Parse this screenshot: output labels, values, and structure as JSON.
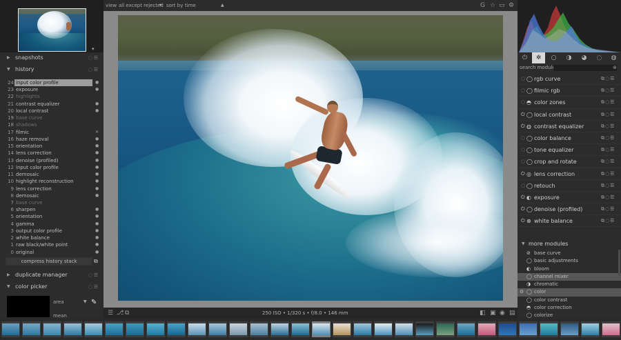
{
  "navigation": {
    "zoom_label": "▾"
  },
  "left_sections": {
    "snapshots": "snapshots",
    "history": "history",
    "duplicate_manager": "duplicate manager",
    "color_picker": "color picker"
  },
  "history": [
    {
      "num": "24",
      "name": "input color profile",
      "state": "●",
      "selected": true,
      "disabled": false
    },
    {
      "num": "23",
      "name": "exposure",
      "state": "●",
      "disabled": false
    },
    {
      "num": "22",
      "name": "highlights",
      "state": "",
      "disabled": true
    },
    {
      "num": "21",
      "name": "contrast equalizer",
      "state": "●",
      "disabled": false
    },
    {
      "num": "20",
      "name": "local contrast",
      "state": "●",
      "disabled": false
    },
    {
      "num": "19",
      "name": "base curve",
      "state": "",
      "disabled": true
    },
    {
      "num": "18",
      "name": "shadows",
      "state": "",
      "disabled": true
    },
    {
      "num": "17",
      "name": "filmic",
      "state": "✕",
      "disabled": false
    },
    {
      "num": "16",
      "name": "haze removal",
      "state": "●",
      "disabled": false
    },
    {
      "num": "15",
      "name": "orientation",
      "state": "●",
      "disabled": false
    },
    {
      "num": "14",
      "name": "lens correction",
      "state": "●",
      "disabled": false
    },
    {
      "num": "13",
      "name": "denoise (profiled)",
      "state": "●",
      "disabled": false
    },
    {
      "num": "12",
      "name": "input color profile",
      "state": "●",
      "disabled": false
    },
    {
      "num": "11",
      "name": "demosaic",
      "state": "●",
      "disabled": false
    },
    {
      "num": "10",
      "name": "highlight reconstruction",
      "state": "●",
      "disabled": false
    },
    {
      "num": "9",
      "name": "lens correction",
      "state": "●",
      "disabled": false
    },
    {
      "num": "8",
      "name": "demosaic",
      "state": "●",
      "disabled": false
    },
    {
      "num": "7",
      "name": "base curve",
      "state": "",
      "disabled": true
    },
    {
      "num": "6",
      "name": "sharpen",
      "state": "●",
      "disabled": false
    },
    {
      "num": "5",
      "name": "orientation",
      "state": "●",
      "disabled": false
    },
    {
      "num": "4",
      "name": "gamma",
      "state": "●",
      "disabled": false
    },
    {
      "num": "3",
      "name": "output color profile",
      "state": "●",
      "disabled": false
    },
    {
      "num": "2",
      "name": "white balance",
      "state": "●",
      "disabled": false
    },
    {
      "num": "1",
      "name": "raw black/white point",
      "state": "●",
      "disabled": false
    },
    {
      "num": "0",
      "name": "original",
      "state": "●",
      "disabled": false
    }
  ],
  "compress_history_label": "compress history stack",
  "color_picker": {
    "area_label": "area",
    "mean_label": "mean",
    "swatch_color": "#000000"
  },
  "topbar": {
    "view_label": "view",
    "filter_value": "all except rejected",
    "sort_label": "sort by",
    "sort_value": "time"
  },
  "exif_info": "250 ISO • 1/320 s • f/8.0 • 146 mm",
  "module_search": {
    "label": "search module",
    "placeholder": ""
  },
  "modules": [
    {
      "name": "rgb curve",
      "on": false,
      "icon": "◯"
    },
    {
      "name": "filmic rgb",
      "on": false,
      "icon": "◯"
    },
    {
      "name": "color zones",
      "on": false,
      "icon": "◓"
    },
    {
      "name": "local contrast",
      "on": true,
      "icon": "◯"
    },
    {
      "name": "contrast equalizer",
      "on": true,
      "icon": "◍"
    },
    {
      "name": "color balance",
      "on": false,
      "icon": "◯"
    },
    {
      "name": "tone equalizer",
      "on": false,
      "icon": "◯"
    },
    {
      "name": "crop and rotate",
      "on": false,
      "icon": "◯"
    },
    {
      "name": "lens correction",
      "on": true,
      "icon": "◎"
    },
    {
      "name": "retouch",
      "on": false,
      "icon": "◯"
    },
    {
      "name": "exposure",
      "on": true,
      "icon": "◐"
    },
    {
      "name": "denoise (profiled)",
      "on": true,
      "icon": "◯"
    },
    {
      "name": "white balance",
      "on": true,
      "icon": "⊕"
    }
  ],
  "more_modules_label": "more modules",
  "more_modules": [
    {
      "name": "base curve",
      "icon": "⊘",
      "disabled": false,
      "hl": false
    },
    {
      "name": "basic adjustments",
      "icon": "◯",
      "disabled": false,
      "hl": false
    },
    {
      "name": "bloom",
      "icon": "◐",
      "disabled": false,
      "hl": false
    },
    {
      "name": "channel mixer",
      "icon": "◯",
      "disabled": false,
      "hl": true
    },
    {
      "name": "chromatic",
      "icon": "◑",
      "disabled": false,
      "hl": false
    },
    {
      "name": "color",
      "icon": "◯",
      "disabled": false,
      "hl": true
    },
    {
      "name": "color contrast",
      "icon": "◯",
      "disabled": false,
      "hl": false
    },
    {
      "name": "color correction",
      "icon": "◓",
      "disabled": false,
      "hl": false
    },
    {
      "name": "colorize",
      "icon": "◯",
      "disabled": false,
      "hl": false
    }
  ],
  "colors": {
    "accent": "#d8d8d8",
    "panel_bg": "#2c2c2c",
    "center_bg": "#8a8a8a"
  }
}
